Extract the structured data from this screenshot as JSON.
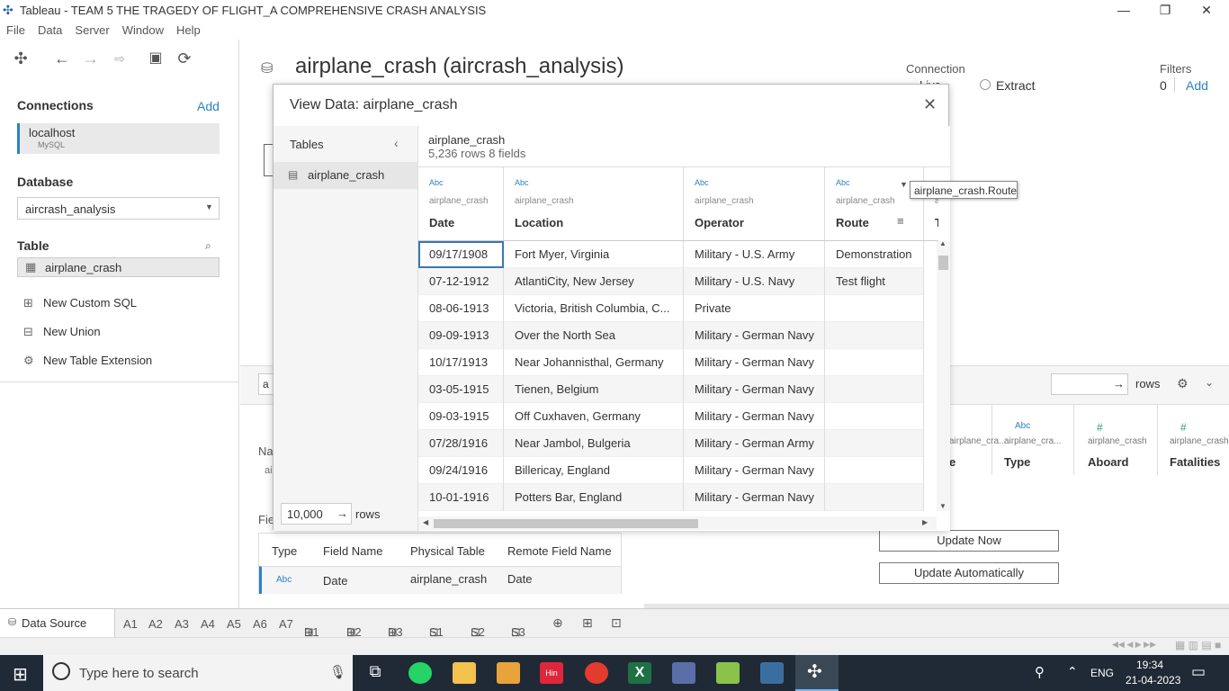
{
  "window": {
    "title": "Tableau - TEAM 5 THE TRAGEDY OF FLIGHT_A COMPREHENSIVE CRASH ANALYSIS"
  },
  "menu": [
    "File",
    "Data",
    "Server",
    "Window",
    "Help"
  ],
  "left": {
    "connections_label": "Connections",
    "add_label": "Add",
    "connection_name": "localhost",
    "connection_type": "MySQL",
    "database_label": "Database",
    "database_value": "aircrash_analysis",
    "table_label": "Table",
    "table_item": "airplane_crash",
    "nav": [
      "New Custom SQL",
      "New Union",
      "New Table Extension"
    ]
  },
  "main": {
    "title": "airplane_crash (aircrash_analysis)",
    "connection_label": "Connection",
    "connection_option_live": "Live",
    "connection_option_extract": "Extract",
    "filters_label": "Filters",
    "filters_count": "0",
    "filters_add": "Add",
    "rows_label": "rows",
    "update_now": "Update Now",
    "update_auto": "Update Automatically",
    "bg_columns": [
      {
        "type": "#",
        "source": "airplane_crash",
        "name": "Fatalities"
      },
      {
        "type": "#",
        "source": "airplane_crash",
        "name": "Aboard"
      },
      {
        "type": "Abc",
        "source": "airplane_cra...",
        "name": "Type"
      },
      {
        "type": "",
        "source": "airplane_cra...",
        "name": "e"
      }
    ],
    "name_label": "Na",
    "fields_label": "Fie",
    "fields_table": {
      "headers": [
        "Type",
        "Field Name",
        "Physical Table",
        "Remote Field Name"
      ],
      "row": {
        "type": "Abc",
        "field": "Date",
        "table": "airplane_crash",
        "remote": "Date"
      }
    }
  },
  "dialog": {
    "title": "View Data: airplane_crash",
    "tables_label": "Tables",
    "table_item": "airplane_crash",
    "rows_value": "10,000",
    "rows_label": "rows",
    "grid_title": "airplane_crash",
    "grid_info": "5,236 rows  8 fields",
    "columns": [
      {
        "type": "Abc",
        "source": "airplane_crash",
        "name": "Date"
      },
      {
        "type": "Abc",
        "source": "airplane_crash",
        "name": "Location"
      },
      {
        "type": "Abc",
        "source": "airplane_crash",
        "name": "Operator"
      },
      {
        "type": "Abc",
        "source": "airplane_crash",
        "name": "Route"
      },
      {
        "type": "",
        "source": "ai",
        "name": "Ty"
      }
    ],
    "rows": [
      [
        "09/17/1908",
        "Fort Myer, Virginia",
        "Military - U.S. Army",
        "Demonstration"
      ],
      [
        "07-12-1912",
        "AtlantiCity, New Jersey",
        "Military - U.S. Navy",
        "Test flight"
      ],
      [
        "08-06-1913",
        "Victoria, British Columbia, C...",
        "Private",
        ""
      ],
      [
        "09-09-1913",
        "Over the North Sea",
        "Military - German Navy",
        ""
      ],
      [
        "10/17/1913",
        "Near Johannisthal, Germany",
        "Military - German Navy",
        ""
      ],
      [
        "03-05-1915",
        "Tienen, Belgium",
        "Military - German Navy",
        ""
      ],
      [
        "09-03-1915",
        "Off Cuxhaven, Germany",
        "Military - German Navy",
        ""
      ],
      [
        "07/28/1916",
        "Near Jambol, Bulgeria",
        "Military - German Army",
        ""
      ],
      [
        "09/24/1916",
        "Billericay, England",
        "Military - German Navy",
        ""
      ],
      [
        "10-01-1916",
        "Potters Bar, England",
        "Military - German Navy",
        ""
      ]
    ],
    "tooltip": "airplane_crash.Route"
  },
  "status_tabs": [
    "Data Source",
    "A1",
    "A2",
    "A3",
    "A4",
    "A5",
    "A6",
    "A7",
    "D1",
    "D2",
    "D3",
    "S1",
    "S2",
    "S3"
  ],
  "taskbar": {
    "search_placeholder": "Type here to search",
    "language": "ENG",
    "time": "19:34",
    "date": "21-04-2023"
  }
}
